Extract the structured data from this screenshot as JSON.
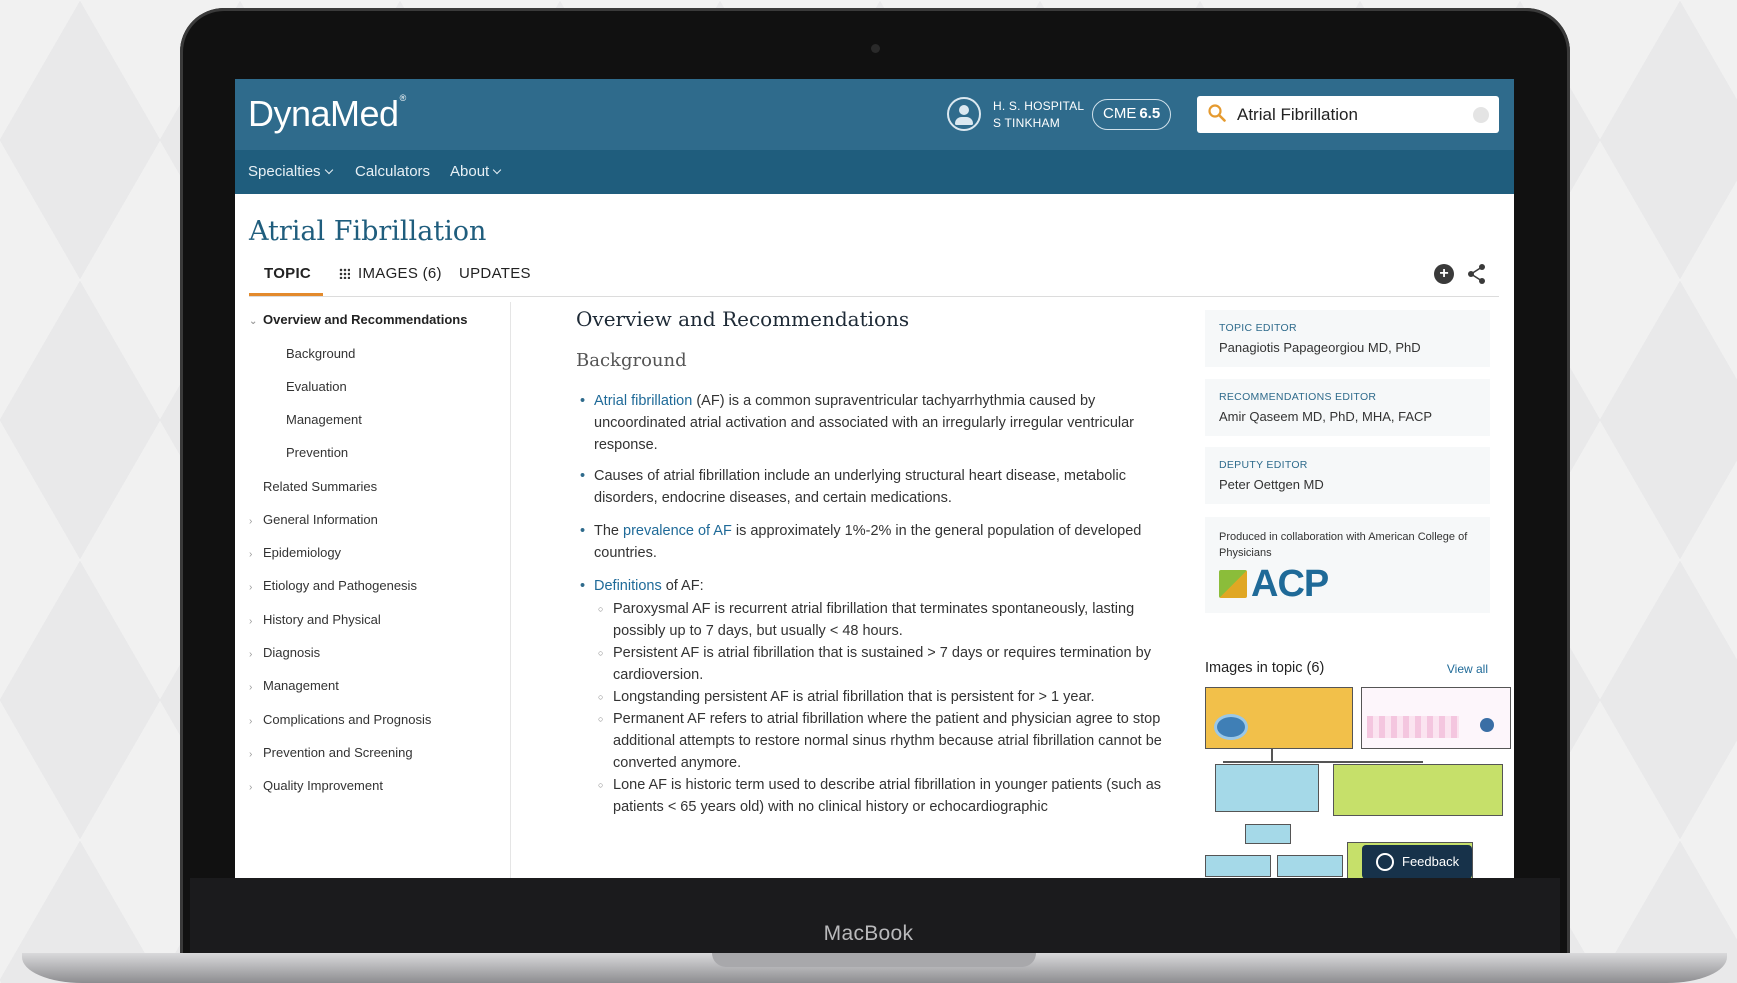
{
  "device": {
    "brand": "MacBook"
  },
  "app": {
    "logo_text": "DynaMed",
    "logo_mark": "®"
  },
  "user": {
    "org": "H. S. HOSPITAL",
    "name": "S TINKHAM"
  },
  "cme": {
    "label": "CME",
    "value": "6.5"
  },
  "search": {
    "value": "Atrial Fibrillation",
    "icon": "search-icon"
  },
  "nav": {
    "items": [
      {
        "label": "Specialties",
        "has_caret": true
      },
      {
        "label": "Calculators",
        "has_caret": false
      },
      {
        "label": "About",
        "has_caret": true
      }
    ]
  },
  "page": {
    "title": "Atrial Fibrillation"
  },
  "tabs": [
    {
      "label": "TOPIC",
      "active": true
    },
    {
      "label": "IMAGES (6)",
      "active": false,
      "icon": "grid-icon"
    },
    {
      "label": "UPDATES",
      "active": false
    }
  ],
  "toolbar": {
    "add_icon": "plus-circle-icon",
    "share_icon": "share-icon"
  },
  "sidebar": {
    "active": "Overview and Recommendations",
    "subitems": [
      "Background",
      "Evaluation",
      "Management",
      "Prevention"
    ],
    "items": [
      "Related Summaries",
      "General Information",
      "Epidemiology",
      "Etiology and Pathogenesis",
      "History and Physical",
      "Diagnosis",
      "Management",
      "Complications and Prognosis",
      "Prevention and Screening",
      "Quality Improvement"
    ]
  },
  "content": {
    "section_title": "Overview and Recommendations",
    "subsection_title": "Background",
    "p1_link": "Atrial fibrillation",
    "p1_text": " (AF) is a common supraventricular tachyarrhythmia caused by uncoordinated atrial activation and associated with an irregularly irregular ventricular response.",
    "p2_text": "Causes of atrial fibrillation include an underlying structural heart disease, metabolic disorders, endocrine diseases, and certain medications.",
    "p3_pre": "The ",
    "p3_link": "prevalence of AF",
    "p3_text": " is approximately 1%-2% in the general population of developed countries.",
    "p4_link": "Definitions",
    "p4_text": " of AF:",
    "definitions": [
      "Paroxysmal AF is recurrent atrial fibrillation that terminates spontaneously, lasting possibly up to 7 days, but usually < 48 hours.",
      "Persistent AF is atrial fibrillation that is sustained > 7 days or requires termination by cardioversion.",
      "Longstanding persistent AF is atrial fibrillation that is persistent for > 1 year.",
      "Permanent AF refers to atrial fibrillation where the patient and physician agree to stop additional attempts to restore normal sinus rhythm because atrial fibrillation cannot be converted anymore.",
      "Lone AF is historic term used to describe atrial fibrillation in younger patients (such as patients < 65 years old) with no clinical history or echocardiographic"
    ]
  },
  "editors": [
    {
      "role": "TOPIC EDITOR",
      "name": "Panagiotis Papageorgiou MD, PhD"
    },
    {
      "role": "RECOMMENDATIONS EDITOR",
      "name": "Amir Qaseem MD, PhD, MHA, FACP"
    },
    {
      "role": "DEPUTY EDITOR",
      "name": "Peter Oettgen MD"
    }
  ],
  "collaboration": {
    "text": "Produced in collaboration with American College of Physicians",
    "logo_text": "ACP"
  },
  "images": {
    "title": "Images in topic (6)",
    "view_all": "View all"
  },
  "feedback": {
    "label": "Feedback"
  }
}
